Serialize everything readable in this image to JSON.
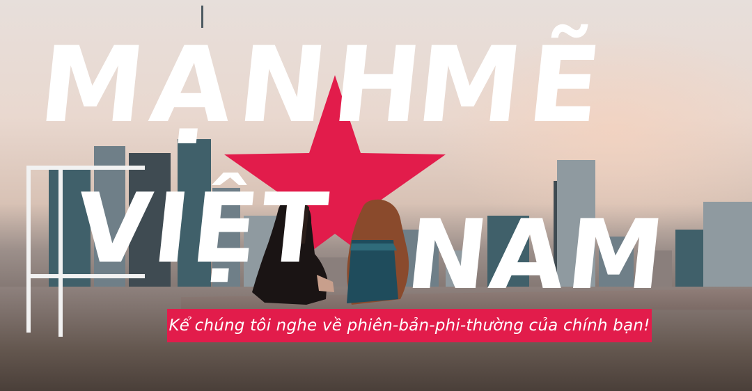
{
  "headline": {
    "word1": "Mạnh",
    "word2": "Mẽ",
    "word3": "Việt",
    "word4": "Nam"
  },
  "tagline": {
    "text": "Kể chúng tôi nghe về phiên-bản-phi-thường của chính bạn!"
  },
  "colors": {
    "accent": "#e21c4b",
    "headline_text": "#ffffff",
    "star": "#e21c4b"
  },
  "icons": {
    "star": "star-icon"
  }
}
